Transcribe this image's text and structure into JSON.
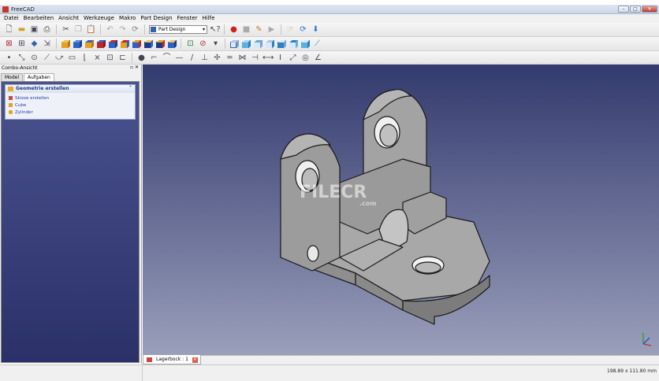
{
  "window": {
    "title": "FreeCAD"
  },
  "menu": [
    "Datei",
    "Bearbeiten",
    "Ansicht",
    "Werkzeuge",
    "Makro",
    "Part Design",
    "Fenster",
    "Hilfe"
  ],
  "toolbar": {
    "workbench": "Part Design"
  },
  "combo": {
    "title": "Combo-Ansicht",
    "tabs": [
      "Model",
      "Aufgaben"
    ],
    "task_header": "Geometrie erstellen",
    "tasks": [
      "Skizze erstellen",
      "Cube",
      "Zylinder"
    ]
  },
  "watermark": {
    "main": "FILECR",
    "sub": ".com"
  },
  "document_tab": "Lagerbock : 1",
  "status": {
    "dimensions": "198.89 x 111.80 mm"
  },
  "colors": {
    "accent": "#1c3fa6",
    "task_bg": "#2b3068",
    "viewport_top": "#333a6e",
    "viewport_bottom": "#9a9fba"
  }
}
